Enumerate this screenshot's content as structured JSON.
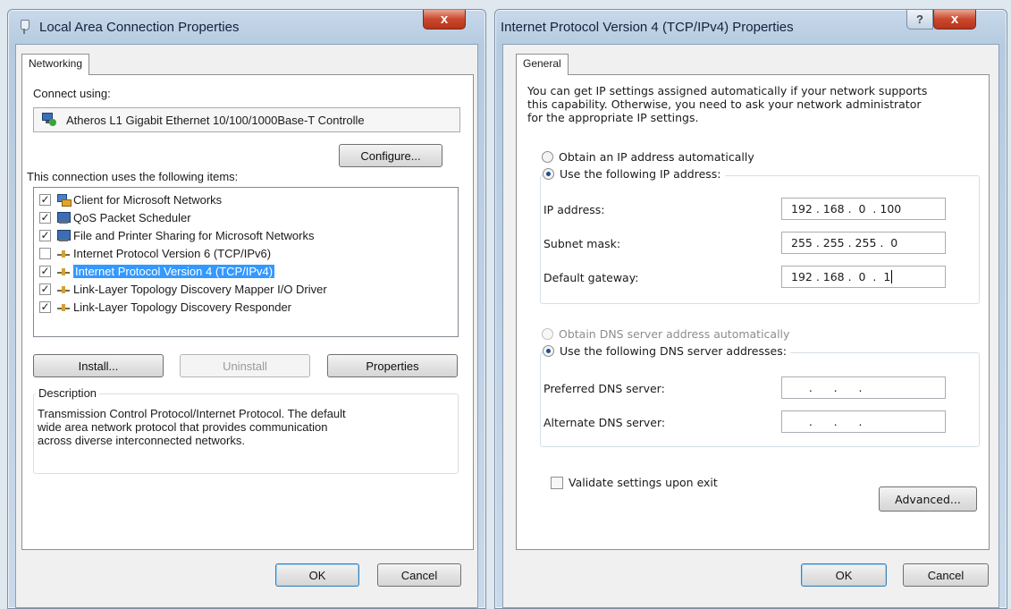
{
  "left_window": {
    "title": "Local Area Connection Properties",
    "close_label": "x",
    "tab_label": "Networking",
    "connect_using_label": "Connect using:",
    "adapter_name": "Atheros L1 Gigabit Ethernet 10/100/1000Base-T Controlle",
    "configure_label": "Configure...",
    "items_label": "This connection uses the following items:",
    "items": [
      {
        "label": "Client for Microsoft Networks",
        "checked": true,
        "icon": "client-icon"
      },
      {
        "label": "QoS Packet Scheduler",
        "checked": true,
        "icon": "qos-icon"
      },
      {
        "label": "File and Printer Sharing for Microsoft Networks",
        "checked": true,
        "icon": "qos-icon"
      },
      {
        "label": "Internet Protocol Version 6 (TCP/IPv6)",
        "checked": false,
        "icon": "protocol-icon"
      },
      {
        "label": "Internet Protocol Version 4 (TCP/IPv4)",
        "checked": true,
        "icon": "protocol-icon",
        "selected": true
      },
      {
        "label": "Link-Layer Topology Discovery Mapper I/O Driver",
        "checked": true,
        "icon": "protocol-icon"
      },
      {
        "label": "Link-Layer Topology Discovery Responder",
        "checked": true,
        "icon": "protocol-icon"
      }
    ],
    "install_label": "Install...",
    "uninstall_label": "Uninstall",
    "properties_label": "Properties",
    "description_title": "Description",
    "description_lines": [
      "Transmission Control Protocol/Internet Protocol. The default",
      "wide area network protocol that provides communication",
      "across diverse interconnected networks."
    ],
    "ok_label": "OK",
    "cancel_label": "Cancel"
  },
  "right_window": {
    "title": "Internet Protocol Version 4 (TCP/IPv4) Properties",
    "help_label": "?",
    "close_label": "x",
    "tab_label": "General",
    "intro_lines": [
      "You can get IP settings assigned automatically if your network supports",
      "this capability. Otherwise, you need to ask your network administrator",
      "for the appropriate IP settings."
    ],
    "obtain_ip_auto_label": "Obtain an IP address automatically",
    "use_following_ip_label": "Use the following IP address:",
    "ip_address_label": "IP address:",
    "ip_address_value": "192 . 168 .  0  . 100",
    "subnet_mask_label": "Subnet mask:",
    "subnet_mask_value": "255 . 255 . 255 .  0",
    "default_gateway_label": "Default gateway:",
    "default_gateway_value": "192 . 168 .  0  .  1",
    "obtain_dns_auto_label": "Obtain DNS server address automatically",
    "use_following_dns_label": "Use the following DNS server addresses:",
    "preferred_dns_label": "Preferred DNS server:",
    "preferred_dns_value": "     .      .      .",
    "alternate_dns_label": "Alternate DNS server:",
    "alternate_dns_value": "     .      .      .",
    "validate_label": "Validate settings upon exit",
    "advanced_label": "Advanced...",
    "ok_label": "OK",
    "cancel_label": "Cancel"
  }
}
